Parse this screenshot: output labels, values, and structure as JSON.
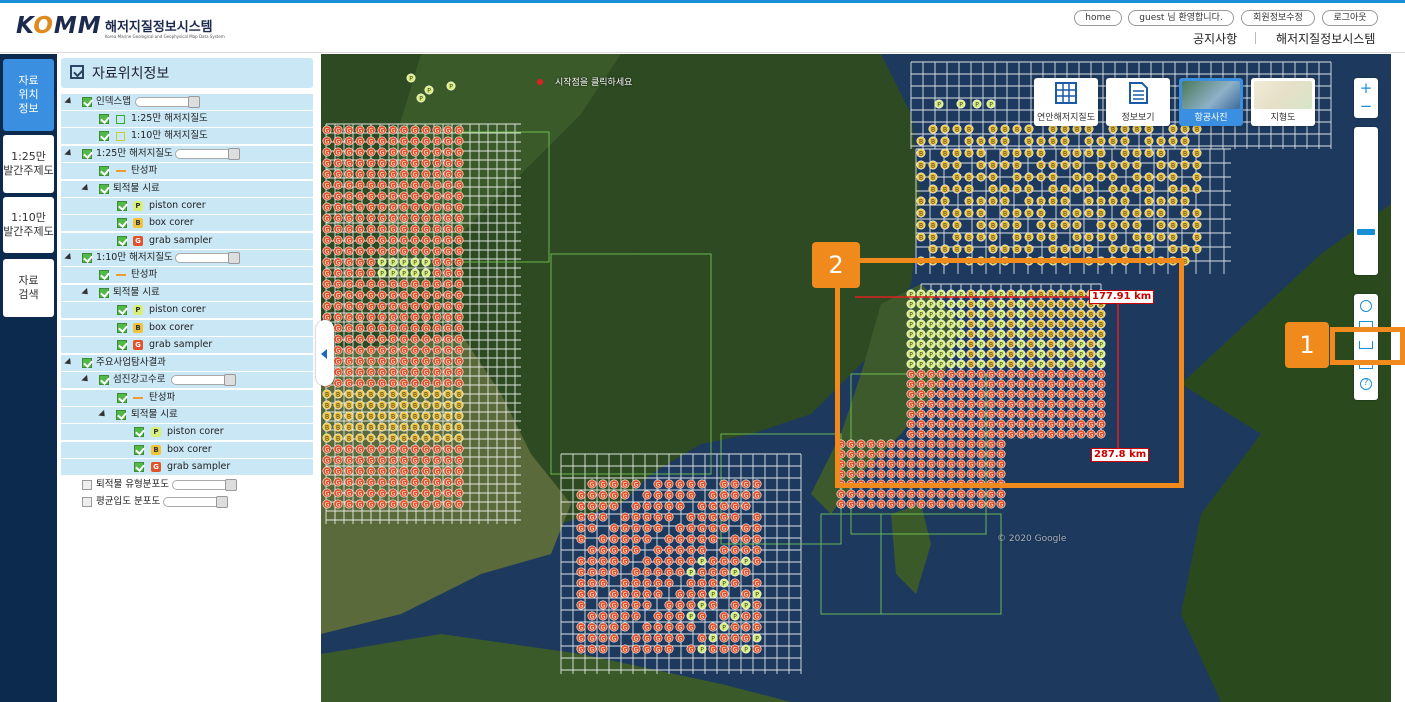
{
  "header": {
    "logo_brand": "KOMM",
    "logo_title": "해저지질정보시스템",
    "logo_subtitle": "Korea Marine Geological and Geophysical Map Data System",
    "util": {
      "home": "home",
      "welcome": "guest 님 환영합니다.",
      "profile": "회원정보수정",
      "logout": "로그아웃"
    },
    "nav": {
      "notice": "공지사항",
      "system": "해저지질정보시스템"
    }
  },
  "leftnav": {
    "items": [
      {
        "label": "자료\n위치\n정보",
        "active": true
      },
      {
        "label": "1:25만\n발간주제도",
        "active": false
      },
      {
        "label": "1:10만\n발간주제도",
        "active": false
      },
      {
        "label": "자료\n검색",
        "active": false
      }
    ]
  },
  "panel": {
    "title": "자료위치정보",
    "tree": {
      "index_map": "인덱스맵",
      "index_25": "1:25만 해저지질도",
      "index_10": "1:10만 해저지질도",
      "geo25": "1:25만 해저지질도",
      "seismic": "탄성파",
      "sediment": "퇴적물 시료",
      "piston": "piston corer",
      "box": "box corer",
      "grab": "grab sampler",
      "geo10": "1:10만 해저지질도",
      "project": "주요사업탐사결과",
      "seomjin": "섬진강고수로",
      "sed_type": "퇴적물 유형분포도",
      "grain": "평균입도 분포도"
    }
  },
  "map": {
    "hint": "시작점을 클릭하세요",
    "watermark": "© 2020 Google",
    "measure_1": "177.91 km",
    "measure_2": "287.8 km",
    "buttons": {
      "coastal": "연안해저지질도",
      "info": "정보보기",
      "satellite": "항공사진",
      "terrain": "지형도"
    },
    "zoom_in": "+",
    "zoom_out": "−"
  },
  "callouts": {
    "one": "1",
    "two": "2"
  },
  "colors": {
    "accent": "#f08a1c",
    "nav_bg": "#0c2a4e",
    "active": "#3b8fe0",
    "panel_row": "#c9e7f5"
  },
  "icons": [
    "refresh-icon",
    "mail-icon",
    "ruler-icon",
    "print-icon",
    "help-icon",
    "grid-icon",
    "document-icon"
  ]
}
